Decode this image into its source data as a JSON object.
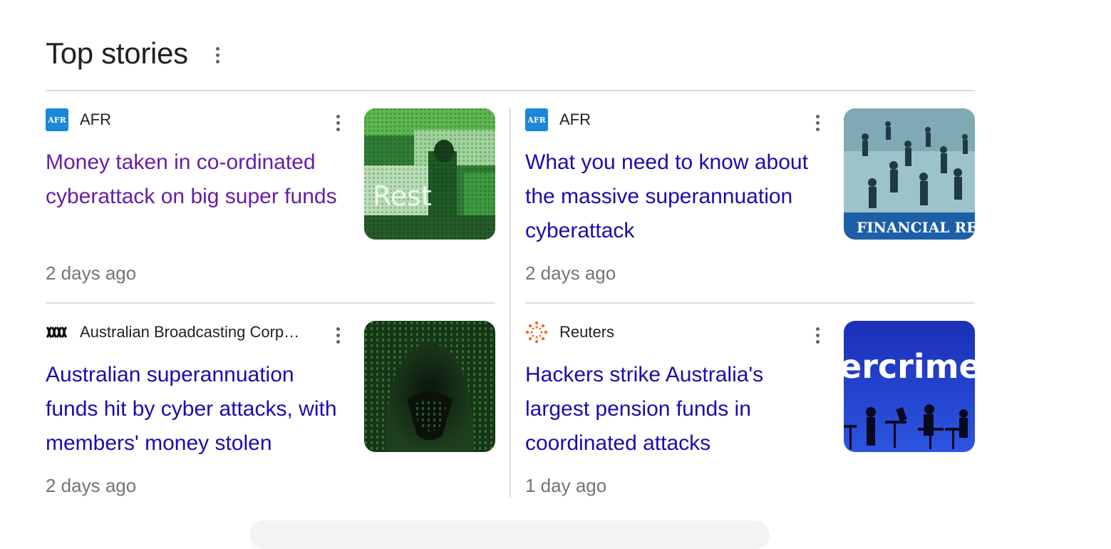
{
  "section": {
    "title": "Top stories"
  },
  "stories": [
    {
      "source": "AFR",
      "source_icon": "afr-logo-icon",
      "headline": "Money taken in co-ordinated cyberattack on big super funds",
      "time": "2 days ago",
      "visited": true,
      "image_text": "Rest"
    },
    {
      "source": "AFR",
      "source_icon": "afr-logo-icon",
      "headline": "What you need to know about the massive superannuation cyberattack",
      "time": "2 days ago",
      "visited": false,
      "image_text": "FINANCIAL REVIE"
    },
    {
      "source": "Australian Broadcasting Corp…",
      "source_icon": "abc-logo-icon",
      "headline": "Australian superannuation funds hit by cyber attacks, with members' money stolen",
      "time": "2 days ago",
      "visited": false,
      "image_text": ""
    },
    {
      "source": "Reuters",
      "source_icon": "reuters-logo-icon",
      "headline": "Hackers strike Australia's largest pension funds in coordinated attacks",
      "time": "1 day ago",
      "visited": false,
      "image_text": "ercrime"
    }
  ],
  "afr_logo_text": "AFR",
  "colors": {
    "link": "#1a0dab",
    "visited": "#681da8",
    "meta": "#70757a",
    "afr": "#1a87d8"
  }
}
